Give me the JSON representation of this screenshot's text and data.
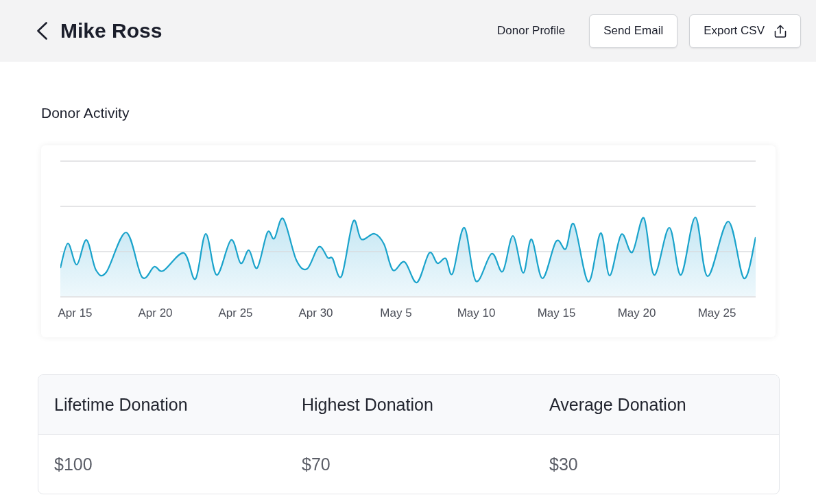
{
  "header": {
    "title": "Mike Ross",
    "profile_link": "Donor Profile",
    "buttons": [
      {
        "label": "Send Email",
        "kind": "text"
      },
      {
        "label": "Export CSV",
        "kind": "with_icon"
      }
    ]
  },
  "activity": {
    "title": "Donor Activity",
    "x_labels": [
      "Apr 15",
      "Apr 20",
      "Apr 25",
      "Apr 30",
      "May 5",
      "May 10",
      "May 15",
      "May 20",
      "May 25"
    ]
  },
  "table": {
    "columns": [
      "Lifetime Donation",
      "Highest Donation",
      "Average Donation"
    ],
    "rows": [
      [
        "$100",
        "$70",
        "$30"
      ]
    ]
  }
}
